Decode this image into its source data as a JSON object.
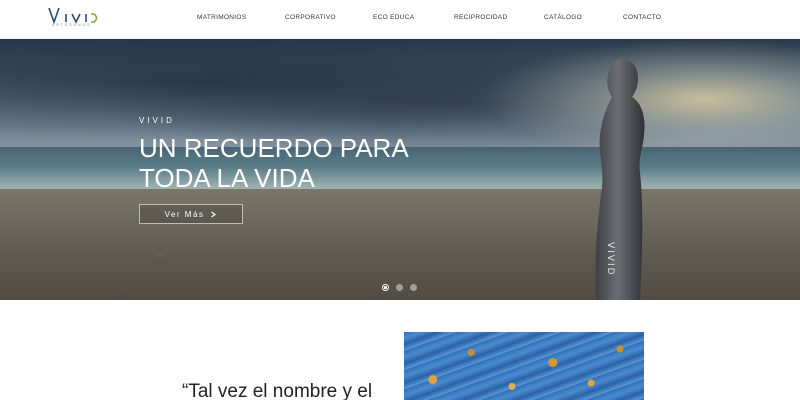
{
  "header": {
    "logo_text": "VIVID",
    "logo_sub": "ARTESANOS",
    "nav": [
      {
        "label": "MATRIMONIOS"
      },
      {
        "label": "CORPORATIVO"
      },
      {
        "label": "ECO EDUCA"
      },
      {
        "label": "RECIPROCIDAD"
      },
      {
        "label": "CATÁLOGO"
      },
      {
        "label": "CONTACTO"
      }
    ]
  },
  "hero": {
    "label": "VIVID",
    "title_line1": "UN RECUERDO PARA",
    "title_line2": "TODA LA VIDA",
    "button_label": "Ver Más",
    "button_icon": "arrow-right-icon",
    "slides": 3,
    "active_slide": 1
  },
  "content": {
    "quote": "“Tal vez el nombre y el"
  }
}
